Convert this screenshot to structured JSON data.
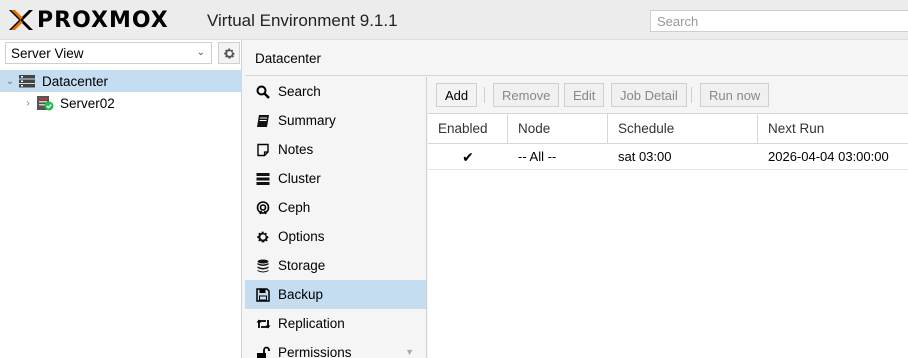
{
  "header": {
    "brand": "PROXMOX",
    "version": "Virtual Environment 9.1.1",
    "search_placeholder": "Search"
  },
  "left": {
    "view_select": "Server View",
    "tree": [
      {
        "label": "Datacenter",
        "selected": true
      },
      {
        "label": "Server02",
        "selected": false
      }
    ]
  },
  "content": {
    "title": "Datacenter"
  },
  "menu": [
    {
      "label": "Search",
      "icon": "search-icon"
    },
    {
      "label": "Summary",
      "icon": "book-icon"
    },
    {
      "label": "Notes",
      "icon": "note-icon"
    },
    {
      "label": "Cluster",
      "icon": "server-icon"
    },
    {
      "label": "Ceph",
      "icon": "ceph-icon"
    },
    {
      "label": "Options",
      "icon": "gear-icon"
    },
    {
      "label": "Storage",
      "icon": "database-icon"
    },
    {
      "label": "Backup",
      "icon": "floppy-icon"
    },
    {
      "label": "Replication",
      "icon": "retweet-icon"
    },
    {
      "label": "Permissions",
      "icon": "unlock-icon"
    }
  ],
  "toolbar": {
    "add": "Add",
    "remove": "Remove",
    "edit": "Edit",
    "job_detail": "Job Detail",
    "run_now": "Run now"
  },
  "grid": {
    "columns": [
      "Enabled",
      "Node",
      "Schedule",
      "Next Run"
    ],
    "rows": [
      {
        "enabled": "✔",
        "node": "-- All --",
        "schedule": "sat 03:00",
        "next_run": "2026-04-04 03:00:00"
      }
    ]
  },
  "colors": {
    "accent_orange": "#e57000",
    "selection_blue": "#c4ddf1"
  }
}
